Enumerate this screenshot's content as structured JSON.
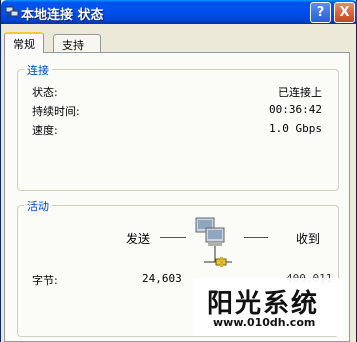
{
  "window": {
    "title": "本地连接 状态",
    "help_label": "?",
    "close_label": "X"
  },
  "tabs": [
    {
      "label": "常规",
      "selected": true
    },
    {
      "label": "支持",
      "selected": false
    }
  ],
  "connection": {
    "legend": "连接",
    "rows": [
      {
        "label": "状态:",
        "value": "已连接上"
      },
      {
        "label": "持续时间:",
        "value": "00:36:42"
      },
      {
        "label": "速度:",
        "value": "1.0 Gbps"
      }
    ]
  },
  "activity": {
    "legend": "活动",
    "sent_label": "发送",
    "received_label": "收到",
    "bytes_label": "字节:",
    "bytes_sent": "24,603",
    "bytes_received": "400,011"
  },
  "watermark": {
    "brand": "阳光系统",
    "url": "www.010dh.com"
  }
}
